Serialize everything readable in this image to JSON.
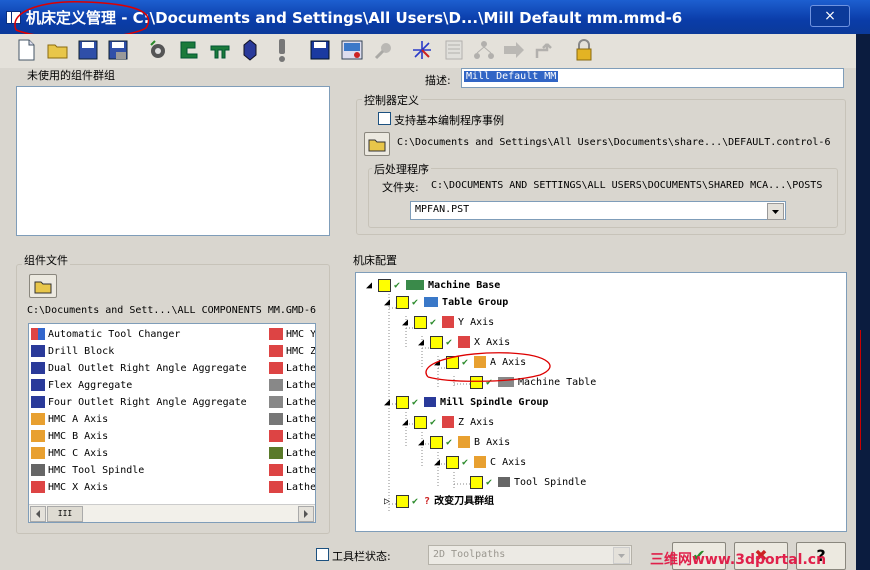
{
  "window": {
    "title": "机床定义管理 - C:\\Documents and Settings\\All Users\\D...\\Mill Default mm.mmd-6",
    "close_label": "×"
  },
  "toolbar": {
    "icons": [
      "new-icon",
      "open-icon",
      "save-icon",
      "save-as-icon",
      "rotary-icon",
      "machine-icon",
      "tool-icon",
      "spindle-icon",
      "warning-icon",
      "disk-icon",
      "machine-config-icon",
      "connect-icon",
      "axes-icon",
      "list-icon",
      "tree-icon",
      "arrow-icon",
      "branch-icon",
      "lock-icon"
    ]
  },
  "unused_groups": {
    "label": "未使用的组件群组"
  },
  "description": {
    "label": "描述:",
    "value": "Mill Default MM"
  },
  "controller": {
    "label": "控制器定义",
    "support_label": "支持基本编制程序事例",
    "path": "C:\\Documents and Settings\\All Users\\Documents\\share...\\DEFAULT.control-6"
  },
  "post": {
    "label": "后处理程序",
    "folder_label": "文件夹:",
    "folder_path": "C:\\DOCUMENTS AND SETTINGS\\ALL USERS\\DOCUMENTS\\SHARED MCA...\\POSTS",
    "selected": "MPFAN.PST"
  },
  "component_files": {
    "label": "组件文件",
    "path": "C:\\Documents and Sett...\\ALL COMPONENTS MM.GMD-6",
    "items": [
      "Automatic Tool Changer",
      "Drill Block",
      "Dual Outlet Right Angle Aggregate",
      "Flex Aggregate",
      "Four Outlet Right Angle Aggregate",
      "HMC A Axis",
      "HMC B Axis",
      "HMC C Axis",
      "HMC Tool Spindle",
      "HMC X Axis"
    ],
    "items_col2": [
      "HMC Y",
      "HMC Z",
      "Lathe",
      "Lathe",
      "Lathe",
      "Lathe",
      "Lathe",
      "Lathe",
      "Lathe",
      "Lathe"
    ],
    "scroll_thumb": "III"
  },
  "machine_config": {
    "label": "机床配置",
    "nodes": [
      {
        "label": "Machine Base",
        "level": 0,
        "bold": true
      },
      {
        "label": "Table Group",
        "level": 1,
        "bold": true
      },
      {
        "label": "Y Axis",
        "level": 2,
        "bold": false
      },
      {
        "label": "X Axis",
        "level": 3,
        "bold": false
      },
      {
        "label": "A Axis",
        "level": 4,
        "bold": false
      },
      {
        "label": "Machine Table",
        "level": 5,
        "bold": false
      },
      {
        "label": "Mill Spindle Group",
        "level": 1,
        "bold": true
      },
      {
        "label": "Z Axis",
        "level": 2,
        "bold": false
      },
      {
        "label": "B Axis",
        "level": 3,
        "bold": false
      },
      {
        "label": "C Axis",
        "level": 4,
        "bold": false
      },
      {
        "label": "Tool Spindle",
        "level": 5,
        "bold": false
      },
      {
        "label": "改变刀具群组",
        "level": 1,
        "bold": true
      }
    ]
  },
  "toolbar_state": {
    "label": "工具栏状态:",
    "value": "2D Toolpaths"
  },
  "buttons": {
    "ok": "✔",
    "cancel": "✖",
    "help": "?"
  },
  "watermark": "三维网www.3dportal.cn"
}
